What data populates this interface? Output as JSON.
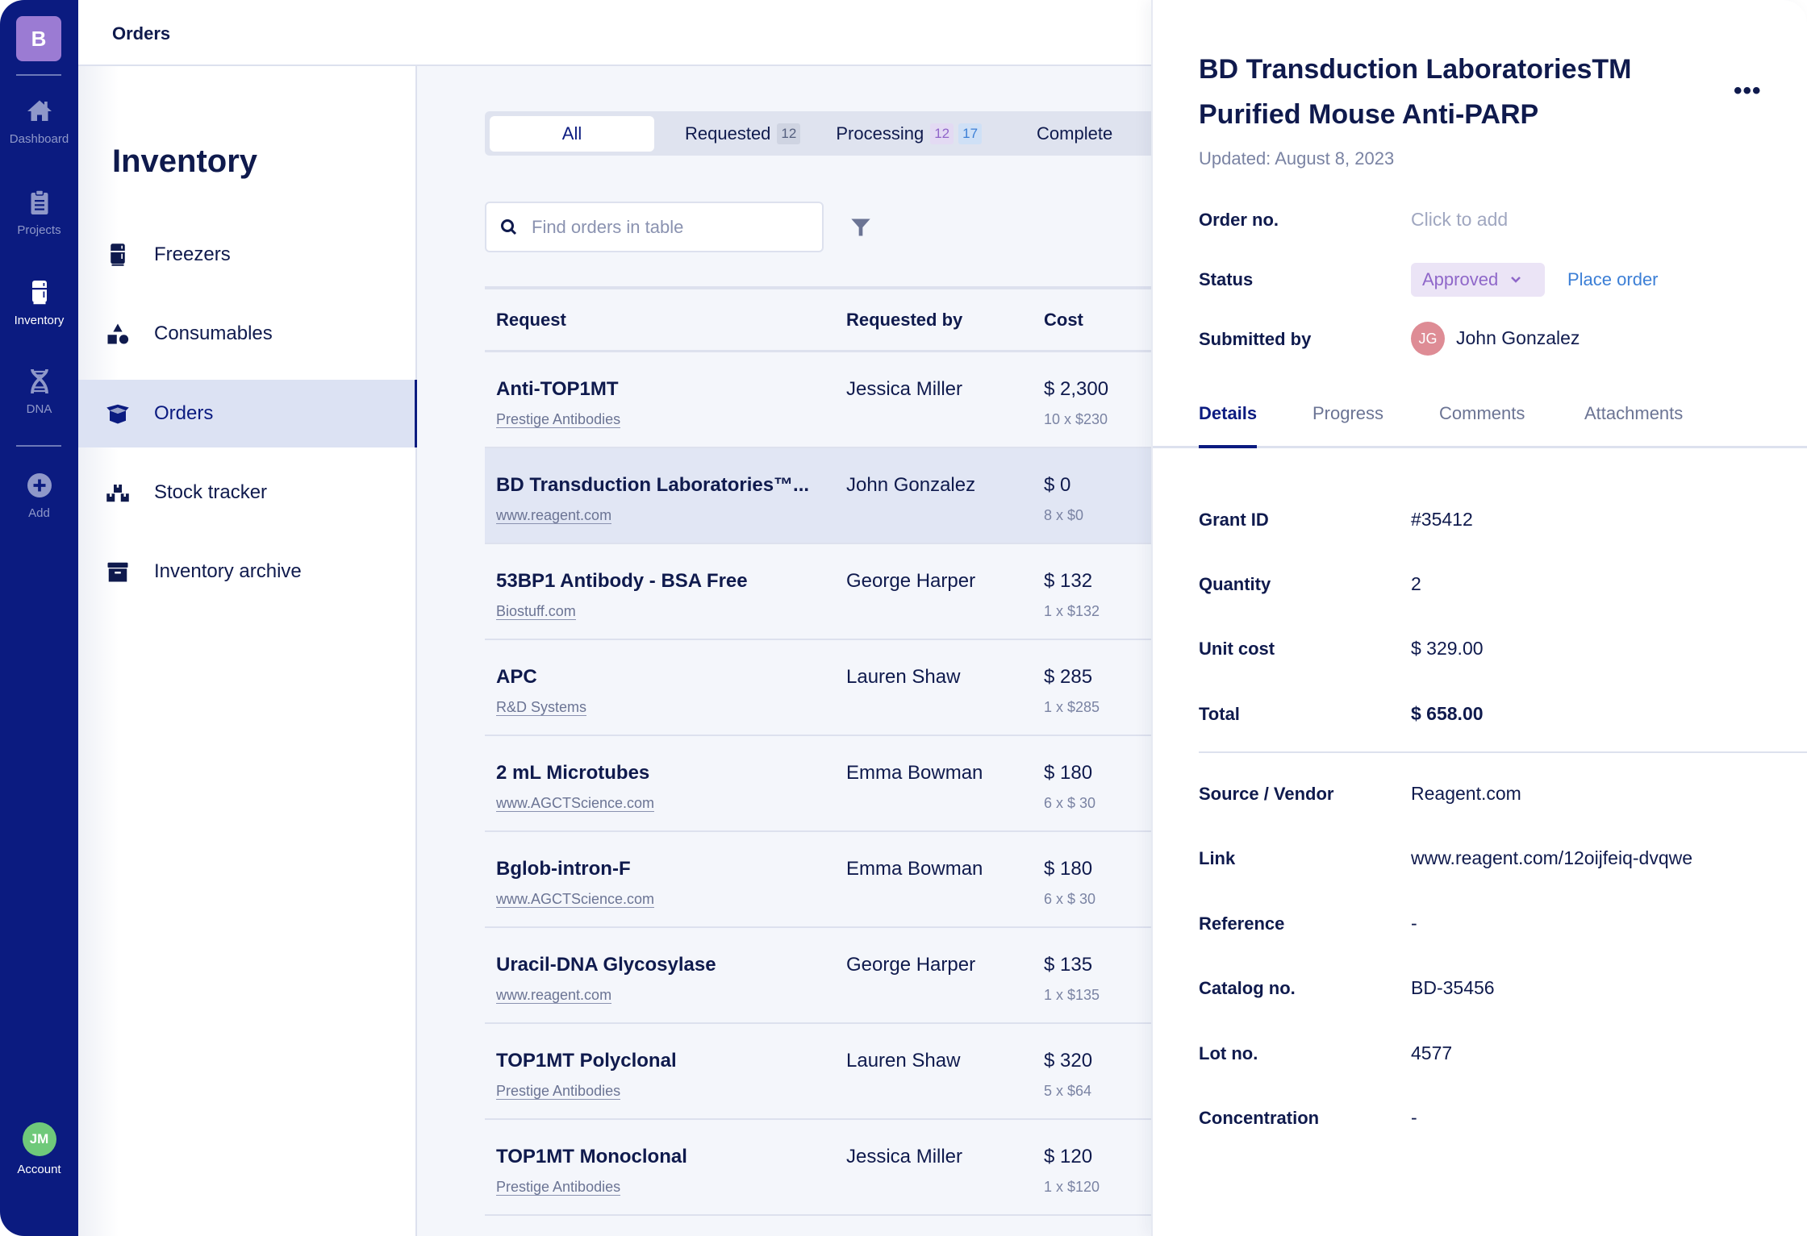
{
  "rail": {
    "logo": "B",
    "items": [
      {
        "label": "Dashboard",
        "icon": "home-icon"
      },
      {
        "label": "Projects",
        "icon": "clipboard-icon"
      },
      {
        "label": "Inventory",
        "icon": "fridge-icon",
        "active": true
      },
      {
        "label": "DNA",
        "icon": "dna-icon"
      },
      {
        "label": "Add",
        "icon": "plus-circle-icon"
      }
    ],
    "account": {
      "initials": "JM",
      "label": "Account"
    }
  },
  "header": {
    "title": "Orders"
  },
  "subnav": {
    "title": "Inventory",
    "items": [
      {
        "label": "Freezers",
        "icon": "fridge-icon"
      },
      {
        "label": "Consumables",
        "icon": "shapes-icon"
      },
      {
        "label": "Orders",
        "icon": "box-icon",
        "active": true
      },
      {
        "label": "Stock tracker",
        "icon": "boxes-icon"
      },
      {
        "label": "Inventory archive",
        "icon": "archive-icon"
      }
    ]
  },
  "main": {
    "tabs": [
      {
        "label": "All",
        "active": true
      },
      {
        "label": "Requested",
        "badges": [
          "12"
        ]
      },
      {
        "label": "Processing",
        "badges": [
          "12",
          "17"
        ]
      },
      {
        "label": "Complete"
      }
    ],
    "search": {
      "placeholder": "Find orders in table",
      "value": ""
    },
    "table": {
      "columns": [
        "Request",
        "Requested by",
        "Cost"
      ],
      "rows": [
        {
          "name": "Anti-TOP1MT",
          "vendor": "Prestige Antibodies",
          "requested_by": "Jessica Miller",
          "cost": "$ 2,300",
          "unit": "10 x $230"
        },
        {
          "name": "BD Transduction Laboratories™...",
          "vendor": "www.reagent.com",
          "requested_by": "John Gonzalez",
          "cost": "$ 0",
          "unit": "8 x $0",
          "selected": true
        },
        {
          "name": "53BP1 Antibody - BSA Free",
          "vendor": "Biostuff.com",
          "requested_by": "George Harper",
          "cost": "$ 132",
          "unit": "1 x $132"
        },
        {
          "name": "APC",
          "vendor": "R&D Systems",
          "requested_by": "Lauren Shaw",
          "cost": "$ 285",
          "unit": "1 x $285"
        },
        {
          "name": "2 mL Microtubes",
          "vendor": "www.AGCTScience.com",
          "requested_by": "Emma Bowman",
          "cost": "$ 180",
          "unit": "6 x $ 30"
        },
        {
          "name": "Bglob-intron-F",
          "vendor": "www.AGCTScience.com",
          "requested_by": "Emma Bowman",
          "cost": "$ 180",
          "unit": "6 x $ 30"
        },
        {
          "name": "Uracil-DNA Glycosylase",
          "vendor": "www.reagent.com",
          "requested_by": "George Harper",
          "cost": "$ 135",
          "unit": "1 x $135"
        },
        {
          "name": "TOP1MT Polyclonal",
          "vendor": "Prestige Antibodies",
          "requested_by": "Lauren Shaw",
          "cost": "$ 320",
          "unit": "5 x $64"
        },
        {
          "name": "TOP1MT Monoclonal",
          "vendor": "Prestige Antibodies",
          "requested_by": "Jessica Miller",
          "cost": "$ 120",
          "unit": "1 x $120"
        }
      ]
    }
  },
  "panel": {
    "title": "BD Transduction LaboratoriesTM Purified Mouse Anti-PARP",
    "more": "•••",
    "updated": "Updated: August 8, 2023",
    "order_no_label": "Order no.",
    "order_no_placeholder": "Click to add",
    "status_label": "Status",
    "status_value": "Approved",
    "place_order": "Place order",
    "submitted_label": "Submitted by",
    "submitter_initials": "JG",
    "submitter_name": "John Gonzalez",
    "tabs": [
      "Details",
      "Progress",
      "Comments",
      "Attachments"
    ],
    "details": [
      {
        "label": "Grant ID",
        "value": "#35412"
      },
      {
        "label": "Quantity",
        "value": "2"
      },
      {
        "label": "Unit cost",
        "value": "$ 329.00"
      },
      {
        "label": "Total",
        "value": "$ 658.00"
      }
    ],
    "details2": [
      {
        "label": "Source / Vendor",
        "value": "Reagent.com"
      },
      {
        "label": "Link",
        "value": "www.reagent.com/12oijfeiq-dvqwe"
      },
      {
        "label": "Reference",
        "value": "-"
      },
      {
        "label": "Catalog no.",
        "value": "BD-35456"
      },
      {
        "label": "Lot no.",
        "value": "4577"
      },
      {
        "label": "Concentration",
        "value": "-"
      }
    ]
  },
  "colors": {
    "rail": "#0b1b80",
    "logo": "#9b7bd3",
    "accent_blue": "#3c7fd6",
    "status_purple": "#8f67c9",
    "avatar_green": "#6fc97a",
    "avatar_pink": "#de8c95"
  }
}
